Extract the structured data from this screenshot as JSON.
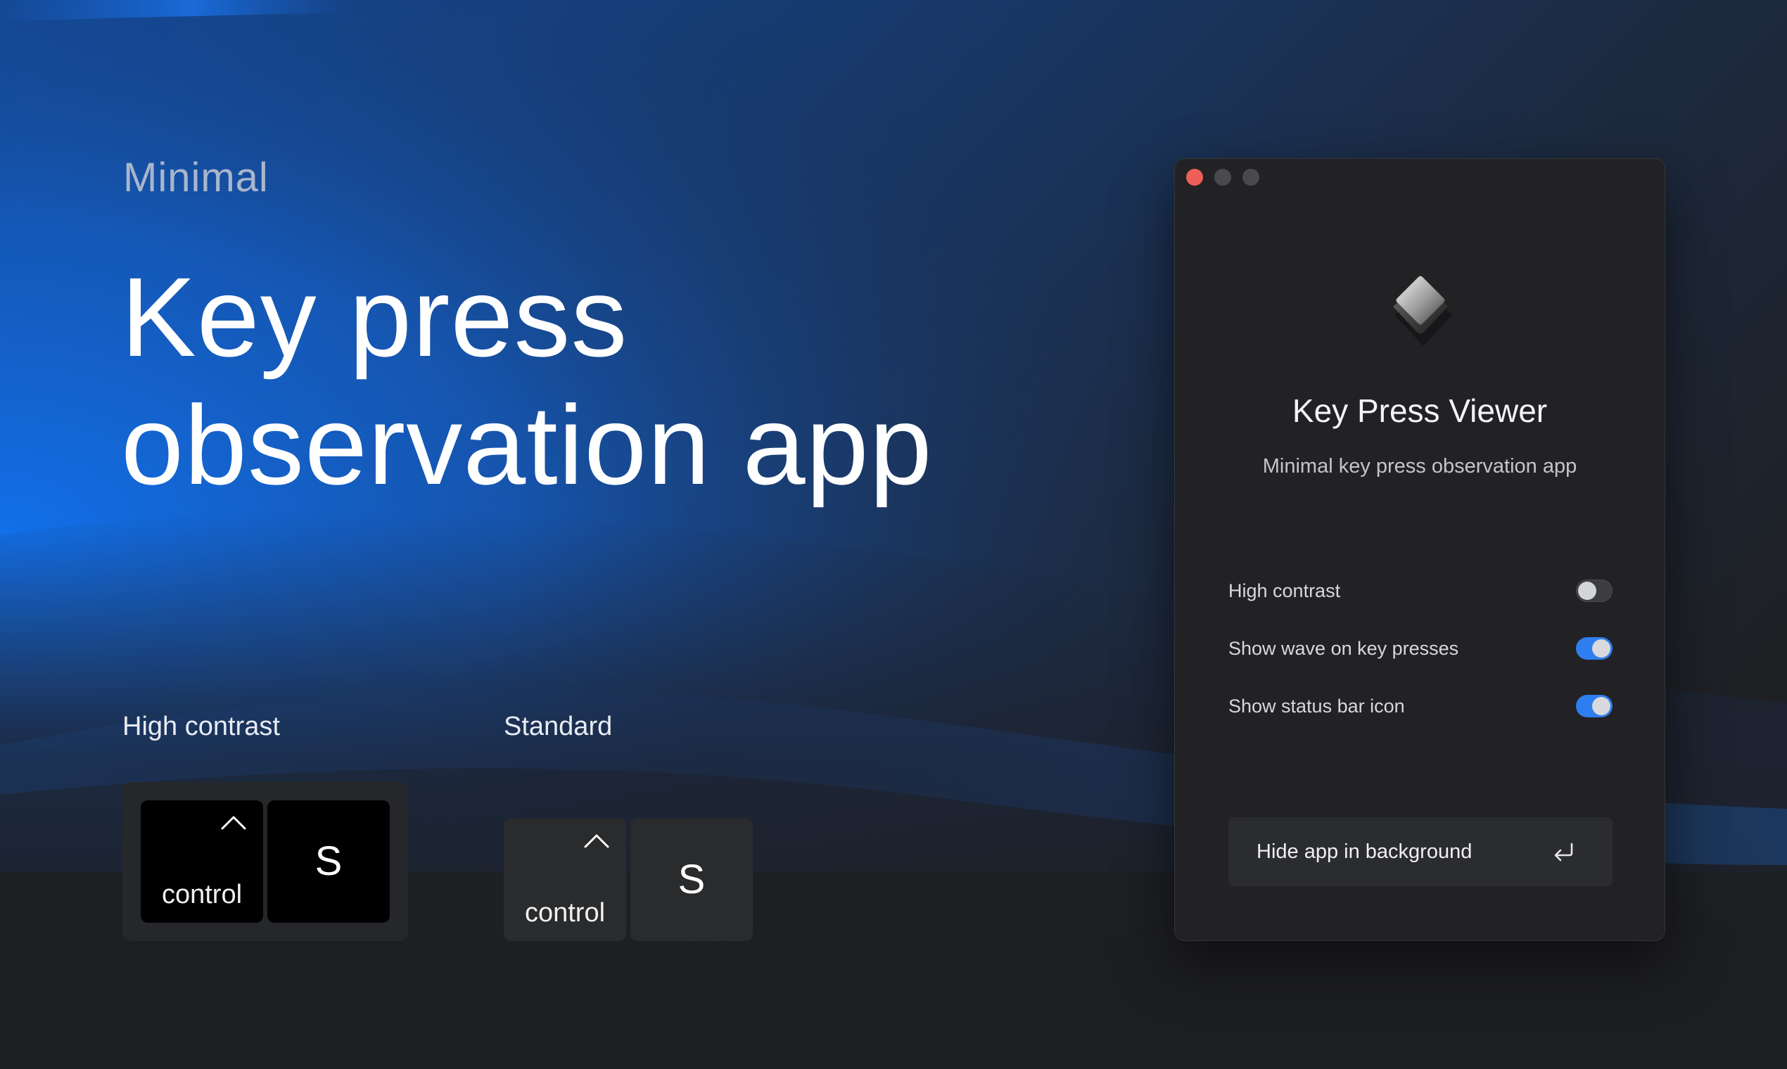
{
  "hero": {
    "eyebrow": "Minimal",
    "headline_line1": "Key press",
    "headline_line2": "observation app"
  },
  "previews": {
    "high_contrast": {
      "label": "High contrast",
      "modifier_key": {
        "symbol_icon": "control-caret-icon",
        "label": "control"
      },
      "char_key": {
        "label": "S"
      }
    },
    "standard": {
      "label": "Standard",
      "modifier_key": {
        "symbol_icon": "control-caret-icon",
        "label": "control"
      },
      "char_key": {
        "label": "S"
      }
    }
  },
  "window": {
    "traffic_lights": [
      "close",
      "minimize",
      "zoom"
    ],
    "app_icon": "keycap-diamond-icon",
    "title": "Key Press Viewer",
    "subtitle": "Minimal key press observation app",
    "settings": [
      {
        "label": "High contrast",
        "enabled": false
      },
      {
        "label": "Show wave on key presses",
        "enabled": true
      },
      {
        "label": "Show status bar icon",
        "enabled": true
      }
    ],
    "hide_button": {
      "label": "Hide app in background",
      "icon": "return-key-icon"
    }
  },
  "colors": {
    "accent": "#2f7ef0",
    "close_button": "#ee5f57",
    "window_bg": "#222224",
    "background_dark": "#1d1e20",
    "background_blue": "#1467d6"
  }
}
